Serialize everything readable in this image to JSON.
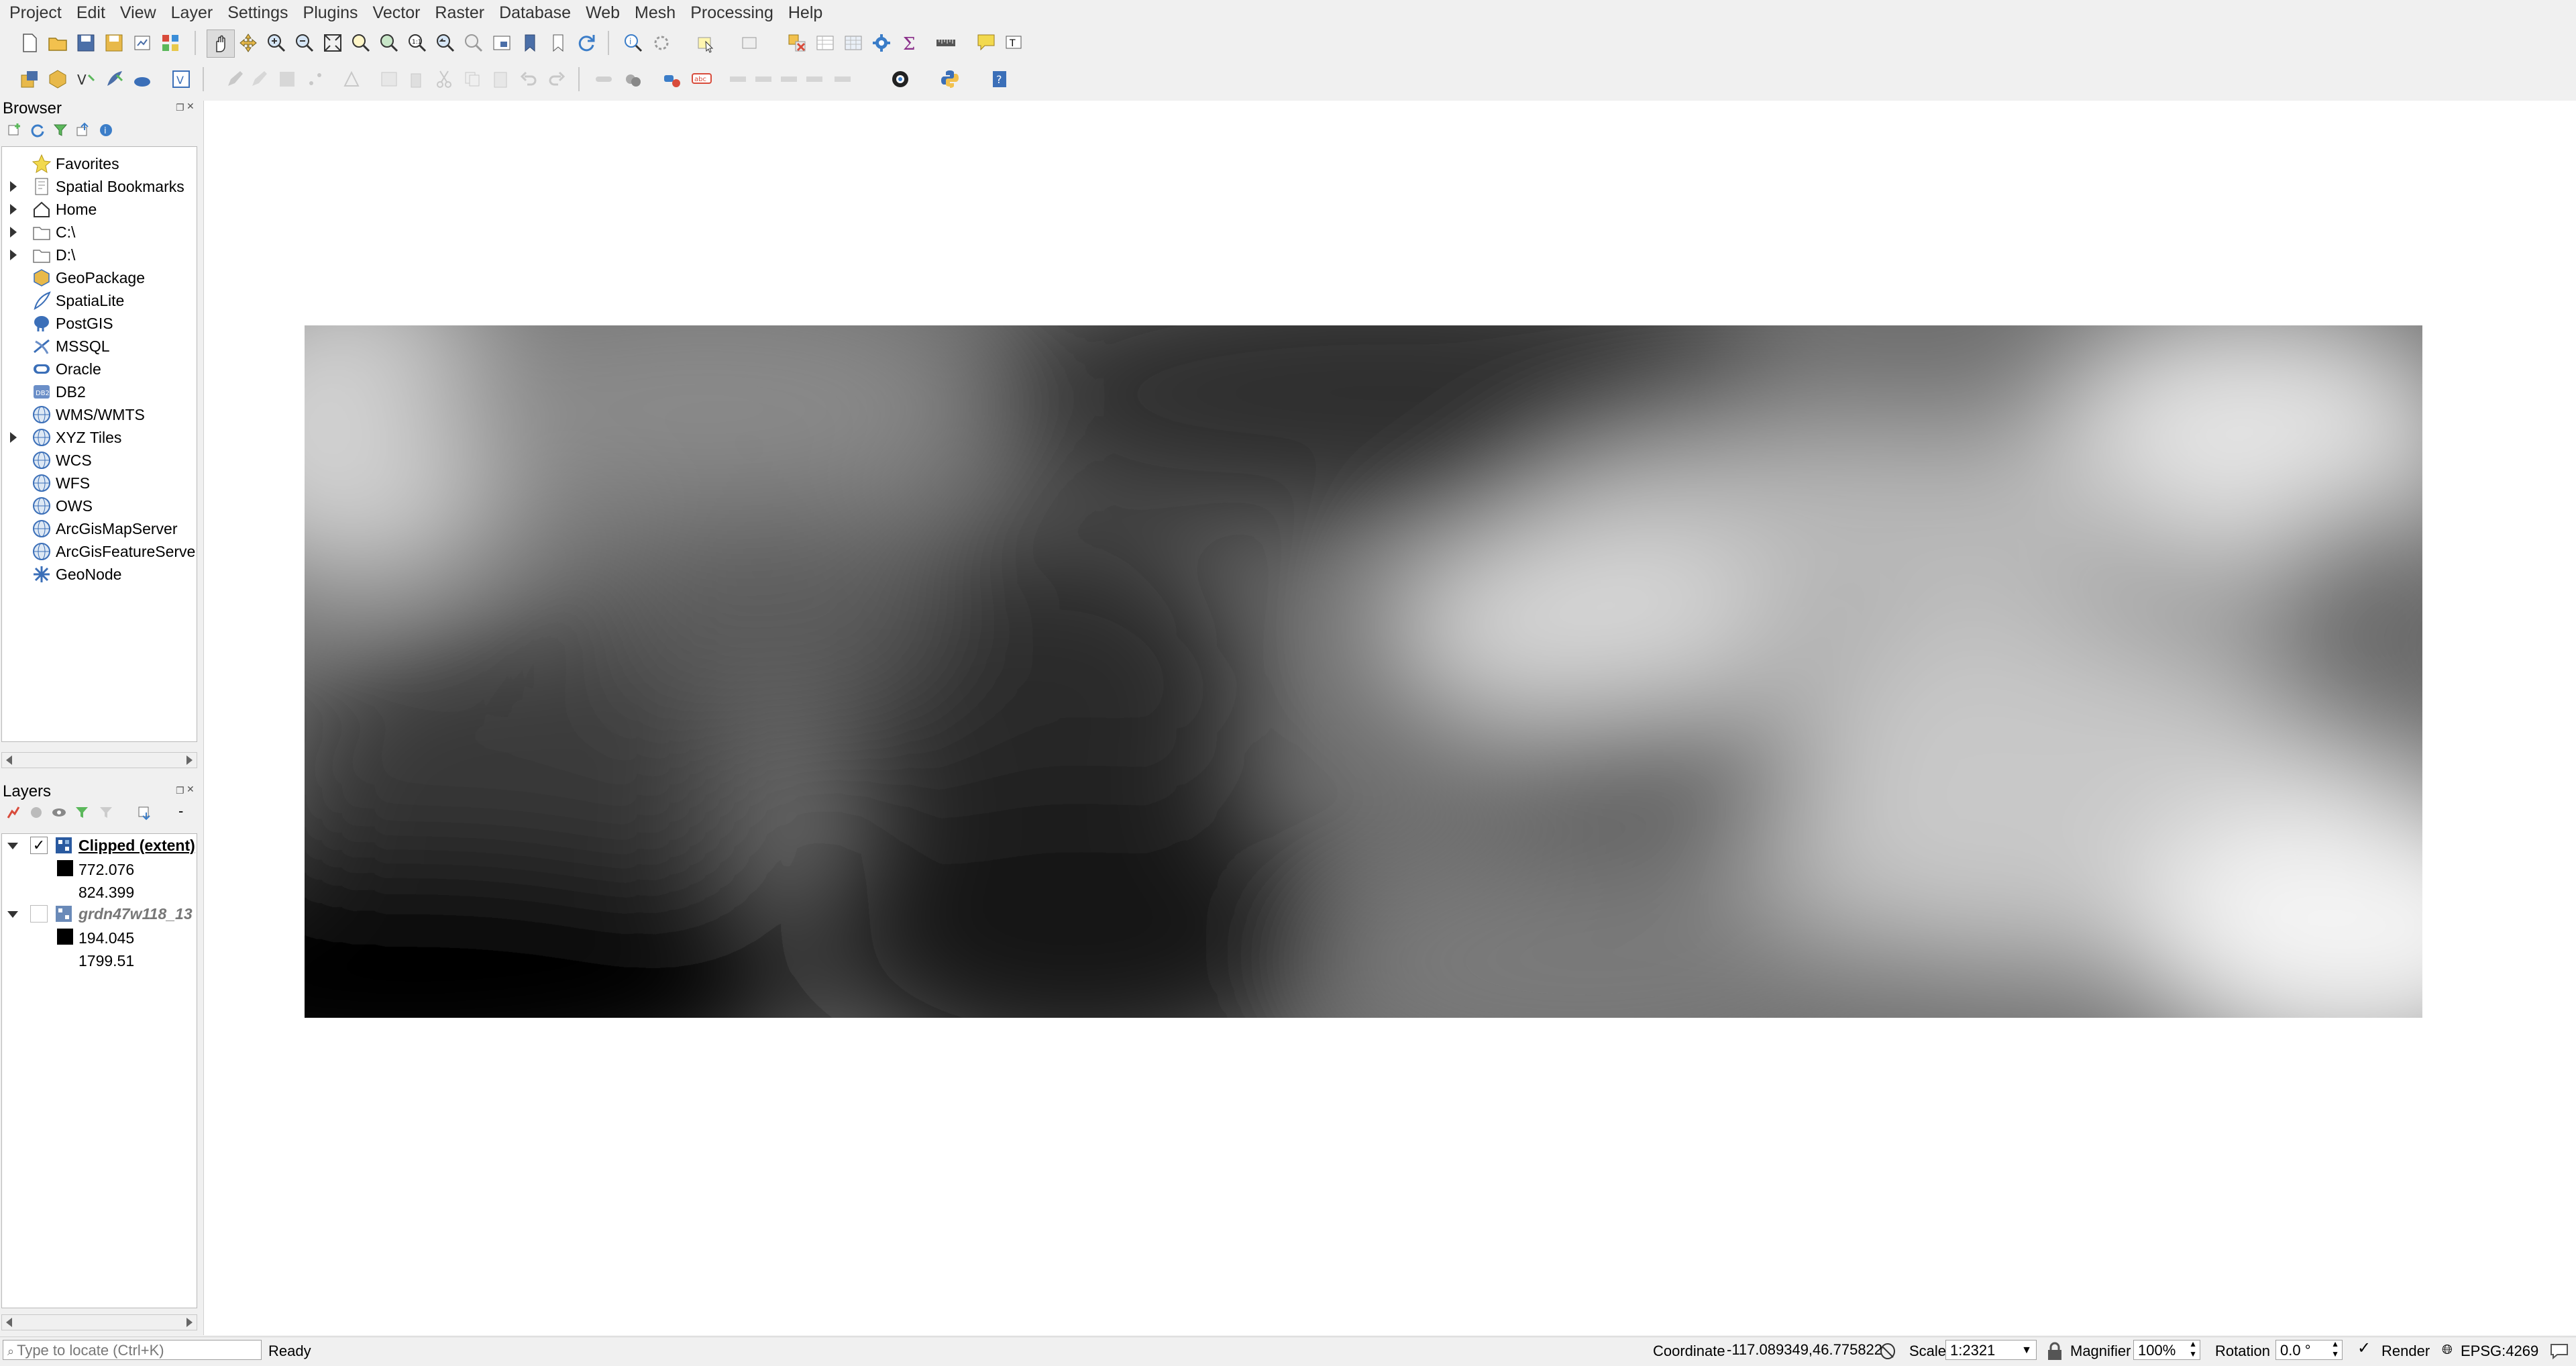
{
  "menu": [
    "Project",
    "Edit",
    "View",
    "Layer",
    "Settings",
    "Plugins",
    "Vector",
    "Raster",
    "Database",
    "Web",
    "Mesh",
    "Processing",
    "Help"
  ],
  "browser": {
    "title": "Browser",
    "items": [
      {
        "label": "Favorites",
        "icon": "star-icon",
        "expandable": false
      },
      {
        "label": "Spatial Bookmarks",
        "icon": "bookmark-icon",
        "expandable": true
      },
      {
        "label": "Home",
        "icon": "home-icon",
        "expandable": true
      },
      {
        "label": "C:\\",
        "icon": "folder-icon",
        "expandable": true
      },
      {
        "label": "D:\\",
        "icon": "folder-icon",
        "expandable": true
      },
      {
        "label": "GeoPackage",
        "icon": "geopackage-icon",
        "expandable": false
      },
      {
        "label": "SpatiaLite",
        "icon": "feather-icon",
        "expandable": false
      },
      {
        "label": "PostGIS",
        "icon": "elephant-icon",
        "expandable": false
      },
      {
        "label": "MSSQL",
        "icon": "mssql-icon",
        "expandable": false
      },
      {
        "label": "Oracle",
        "icon": "oracle-icon",
        "expandable": false
      },
      {
        "label": "DB2",
        "icon": "db2-icon",
        "expandable": false
      },
      {
        "label": "WMS/WMTS",
        "icon": "globe-icon",
        "expandable": false
      },
      {
        "label": "XYZ Tiles",
        "icon": "globe-icon",
        "expandable": true
      },
      {
        "label": "WCS",
        "icon": "globe-icon",
        "expandable": false
      },
      {
        "label": "WFS",
        "icon": "globe-icon",
        "expandable": false
      },
      {
        "label": "OWS",
        "icon": "globe-icon",
        "expandable": false
      },
      {
        "label": "ArcGisMapServer",
        "icon": "globe-icon",
        "expandable": false
      },
      {
        "label": "ArcGisFeatureServer",
        "icon": "globe-icon",
        "expandable": false
      },
      {
        "label": "GeoNode",
        "icon": "geonode-icon",
        "expandable": false
      }
    ]
  },
  "layers": {
    "title": "Layers",
    "items": [
      {
        "name": "Clipped (extent)",
        "checked": true,
        "min": "772.076",
        "max": "824.399",
        "bold": true
      },
      {
        "name": "grdn47w118_13",
        "checked": false,
        "min": "194.045",
        "max": "1799.51",
        "bold": false
      }
    ]
  },
  "statusbar": {
    "locate_placeholder": "Type to locate (Ctrl+K)",
    "ready": "Ready",
    "coordinate_label": "Coordinate",
    "coordinate_value": "-117.089349,46.775822",
    "scale_label": "Scale",
    "scale_value": "1:2321",
    "magnifier_label": "Magnifier",
    "magnifier_value": "100%",
    "rotation_label": "Rotation",
    "rotation_value": "0.0 °",
    "render_label": "Render",
    "crs": "EPSG:4269"
  },
  "colors": {
    "background": "#f0f0f0",
    "canvas": "#ffffff",
    "raster_dark": "#050505",
    "raster_light": "#f2f2f2"
  }
}
